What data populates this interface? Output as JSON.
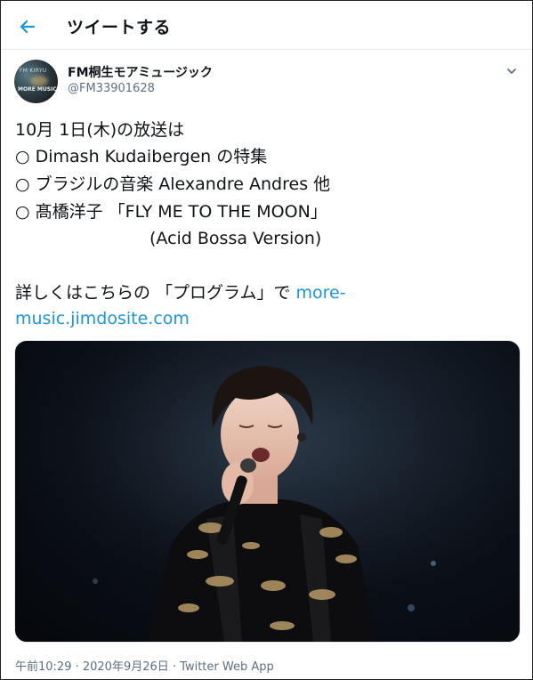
{
  "header": {
    "title": "ツイートする"
  },
  "author": {
    "name": "FM桐生モアミュージック",
    "handle": "@FM33901628",
    "avatar_text_top": "FM KIRYU",
    "avatar_text_bottom": "MORE MUSIC"
  },
  "tweet": {
    "lines": [
      "10月 1日(木)の放送は",
      "○ Dimash Kudaibergen の特集",
      "○ ブラジルの音楽 Alexandre Andres 他",
      "○ 髙橋洋子 「FLY ME TO THE MOON」",
      "                         (Acid Bossa Version)"
    ],
    "detail_prefix": "詳しくはこちらの 「プログラム」で ",
    "link_part1": "more-",
    "link_part2": "music.jimdosite.com"
  },
  "meta": {
    "timestamp": "午前10:29 · 2020年9月26日 · Twitter Web App"
  },
  "colors": {
    "accent": "#1b95e0",
    "secondary_text": "#5b7083"
  }
}
